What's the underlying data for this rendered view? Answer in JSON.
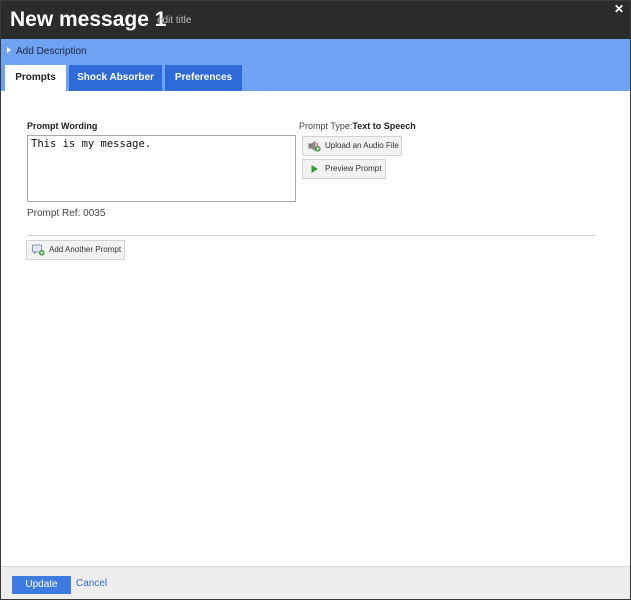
{
  "header": {
    "title": "New message 1",
    "edit_title_link": "edit title",
    "close_glyph": "✕"
  },
  "description": {
    "add_description_label": "Add Description"
  },
  "tabs": [
    {
      "label": "Prompts",
      "active": true
    },
    {
      "label": "Shock Absorber",
      "active": false
    },
    {
      "label": "Preferences",
      "active": false
    }
  ],
  "prompt": {
    "wording_label": "Prompt Wording",
    "wording_value": "This is my message.",
    "ref_text": "Prompt Ref: 0035",
    "type_label": "Prompt Type:",
    "type_value": "Text to Speech",
    "upload_button": "Upload an Audio File",
    "preview_button": "Preview Prompt",
    "add_another_button": "Add Another Prompt"
  },
  "footer": {
    "update_button": "Update",
    "cancel_link": "Cancel"
  },
  "colors": {
    "titlebar": "#2b2b2b",
    "band": "#6ea2f2",
    "tab_inactive": "#2e6bd9",
    "update_button": "#3d7be0",
    "link": "#2e6bd9"
  },
  "icons": {
    "upload": "speaker-upload-icon",
    "preview": "play-icon",
    "add_prompt": "add-prompt-icon"
  }
}
